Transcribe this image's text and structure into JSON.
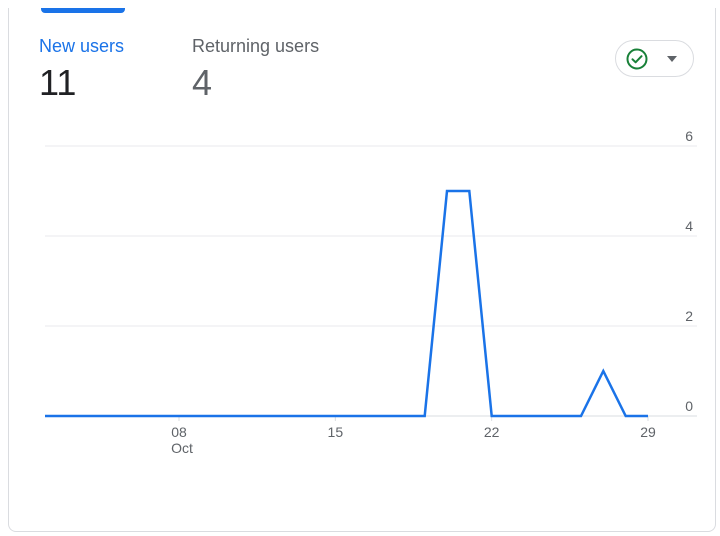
{
  "metrics": [
    {
      "label": "New users",
      "value": "11"
    },
    {
      "label": "Returning users",
      "value": "4"
    }
  ],
  "compare_button": {
    "icon": "check-circle-icon",
    "dropdown_icon": "caret-down-icon",
    "icon_color": "#188038"
  },
  "colors": {
    "accent": "#1a73e8",
    "series": "#1a73e8",
    "gridline": "#e8eaed"
  },
  "chart_data": {
    "type": "line",
    "x": [
      "2023-10-02",
      "2023-10-03",
      "2023-10-04",
      "2023-10-05",
      "2023-10-06",
      "2023-10-07",
      "2023-10-08",
      "2023-10-09",
      "2023-10-10",
      "2023-10-11",
      "2023-10-12",
      "2023-10-13",
      "2023-10-14",
      "2023-10-15",
      "2023-10-16",
      "2023-10-17",
      "2023-10-18",
      "2023-10-19",
      "2023-10-20",
      "2023-10-21",
      "2023-10-22",
      "2023-10-23",
      "2023-10-24",
      "2023-10-25",
      "2023-10-26",
      "2023-10-27",
      "2023-10-28",
      "2023-10-29"
    ],
    "series": [
      {
        "values": [
          0,
          0,
          0,
          0,
          0,
          0,
          0,
          0,
          0,
          0,
          0,
          0,
          0,
          0,
          0,
          0,
          0,
          0,
          5,
          5,
          0,
          0,
          0,
          0,
          0,
          1,
          0,
          0
        ]
      }
    ],
    "xticks": [
      {
        "date": "2023-10-08",
        "label": "08",
        "sublabel": "Oct"
      },
      {
        "date": "2023-10-15",
        "label": "15",
        "sublabel": ""
      },
      {
        "date": "2023-10-22",
        "label": "22",
        "sublabel": ""
      },
      {
        "date": "2023-10-29",
        "label": "29",
        "sublabel": ""
      }
    ],
    "yticks": [
      0,
      2,
      4,
      6
    ],
    "ylim": [
      0,
      6
    ],
    "y_axis_position": "right",
    "grid": true,
    "title": "",
    "xlabel": "",
    "ylabel": ""
  }
}
